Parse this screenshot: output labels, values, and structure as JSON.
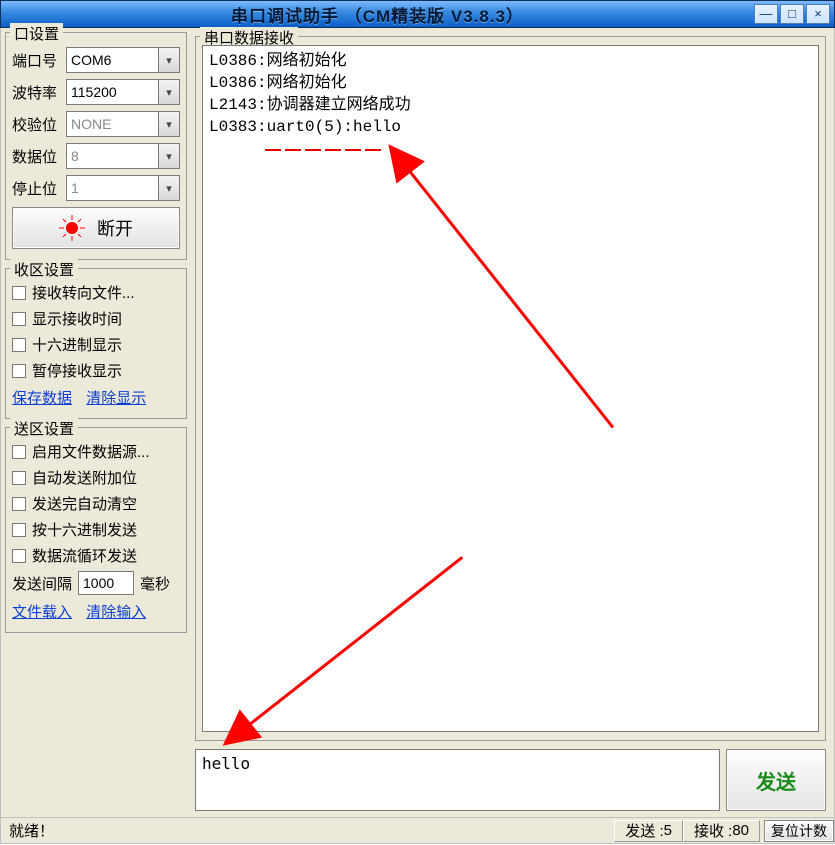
{
  "window": {
    "title": "串口调试助手 （CM精装版 V3.8.3）"
  },
  "port_settings": {
    "group_label": "口设置",
    "port_label": "端口号",
    "port_value": "COM6",
    "baud_label": "波特率",
    "baud_value": "115200",
    "parity_label": "校验位",
    "parity_value": "NONE",
    "data_label": "数据位",
    "data_value": "8",
    "stop_label": "停止位",
    "stop_value": "1",
    "disconnect_label": "断开"
  },
  "rx_settings": {
    "group_label": "收区设置",
    "chk_to_file": "接收转向文件...",
    "chk_show_time": "显示接收时间",
    "chk_hex": "十六进制显示",
    "chk_pause": "暂停接收显示",
    "link_save": "保存数据",
    "link_clear": "清除显示"
  },
  "tx_settings": {
    "group_label": "送区设置",
    "chk_file": "启用文件数据源...",
    "chk_auto_extra": "自动发送附加位",
    "chk_clear_after": "发送完自动清空",
    "chk_hex_send": "按十六进制发送",
    "chk_loop": "数据流循环发送",
    "interval_label_pre": "发送间隔",
    "interval_value": "1000",
    "interval_unit": "毫秒",
    "link_file": "文件载入",
    "link_clear": "清除输入"
  },
  "rx_area": {
    "group_label": "串口数据接收",
    "lines": [
      "L0386:网络初始化",
      "L0386:网络初始化",
      "L2143:协调器建立网络成功",
      "L0383:uart0(5):hello"
    ]
  },
  "send": {
    "text": "hello",
    "button": "发送"
  },
  "status": {
    "ready": "就绪！",
    "sent_label": "发送 : ",
    "sent_value": "5",
    "recv_label": "接收 : ",
    "recv_value": "80",
    "reset_btn": "复位计数"
  }
}
